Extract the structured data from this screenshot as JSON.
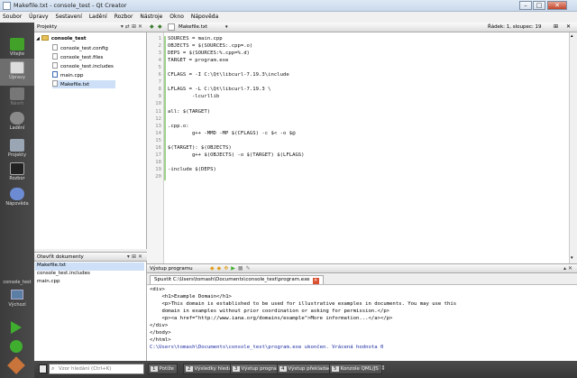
{
  "window": {
    "title": "Makefile.txt - console_test - Qt Creator"
  },
  "menu": [
    "Soubor",
    "Úpravy",
    "Sestavení",
    "Ladění",
    "Rozbor",
    "Nástroje",
    "Okno",
    "Nápověda"
  ],
  "modes": [
    {
      "label": "Vítejte",
      "state": "normal"
    },
    {
      "label": "Úpravy",
      "state": "active"
    },
    {
      "label": "Návrh",
      "state": "disabled"
    },
    {
      "label": "Ladění",
      "state": "normal"
    },
    {
      "label": "Projekty",
      "state": "normal"
    },
    {
      "label": "Rozbor",
      "state": "normal"
    },
    {
      "label": "Nápověda",
      "state": "normal"
    }
  ],
  "target": {
    "project": "console_test",
    "config": "Výchozí"
  },
  "projects_panel": {
    "title": "Projekty",
    "root": "console_test",
    "files": [
      "console_test.config",
      "console_test.files",
      "console_test.includes",
      "main.cpp",
      "Makefile.txt"
    ],
    "selected": "Makefile.txt"
  },
  "open_documents": {
    "title": "Otevřít dokumenty",
    "items": [
      "Makefile.txt",
      "console_test.includes",
      "main.cpp"
    ],
    "selected": "Makefile.txt"
  },
  "editor": {
    "filename": "Makefile.txt",
    "position": "Řádek: 1, sloupec: 19",
    "lines": [
      "SOURCES = main.cpp",
      "OBJECTS = $(SOURCES:.cpp=.o)",
      "DEPS = $(SOURCES:%.cpp=%.d)",
      "TARGET = program.exe",
      "",
      "CFLAGS = -I C:\\Qt\\libcurl-7.19.3\\include",
      "",
      "LFLAGS = -L C:\\Qt\\libcurl-7.19.3 \\",
      "        -lcurllib",
      "",
      "all: $(TARGET)",
      "",
      ".cpp.o:",
      "        g++ -MMD -MP $(CFLAGS) -c $< -o $@",
      "",
      "$(TARGET): $(OBJECTS)",
      "        g++ $(OBJECTS) -o $(TARGET) $(LFLAGS)",
      "",
      "-include $(DEPS)",
      ""
    ]
  },
  "output": {
    "title": "Výstup programu",
    "run_tab": "Spustit C:\\Users\\tomash\\Documents\\console_test\\program.exe",
    "lines": [
      "<div>",
      "    <h1>Example Domain</h1>",
      "    <p>This domain is established to be used for illustrative examples in documents. You may use this",
      "    domain in examples without prior coordination or asking for permission.</p>",
      "    <p><a href=\"http://www.iana.org/domains/example\">More information...</a></p>",
      "</div>",
      "</body>",
      "</html>"
    ],
    "exit_message": "C:\\Users\\tomash\\Documents\\console_test\\program.exe ukončen. Vrácená hodnota 0"
  },
  "statusbar": {
    "search_placeholder": "Vzor hledání (Ctrl+K)",
    "tabs": [
      {
        "num": "1",
        "label": "Potíže"
      },
      {
        "num": "2",
        "label": "Výsledky hledání"
      },
      {
        "num": "3",
        "label": "Výstup programu"
      },
      {
        "num": "4",
        "label": "Výstup překladače"
      },
      {
        "num": "5",
        "label": "Konzole QML/JS"
      }
    ]
  },
  "colors": {
    "modebar": "#3c3c3c",
    "accent_selected": "#cde0f7",
    "run_green": "#3fae2f",
    "exit_text": "#1c2ca4"
  }
}
